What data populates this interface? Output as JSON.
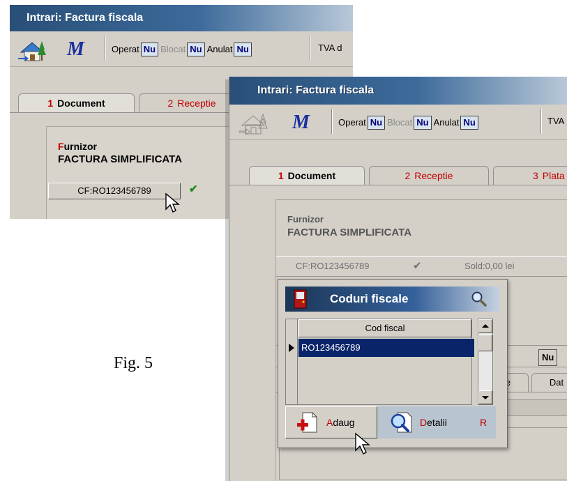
{
  "figure_caption": "Fig. 5",
  "back_window": {
    "title": "Intrari: Factura fiscala",
    "flags": [
      {
        "label": "Operat",
        "value": "Nu"
      },
      {
        "label": "Blocat",
        "value": "Nu"
      },
      {
        "label": "Anulat",
        "value": "Nu"
      }
    ],
    "tva_partial": "TVA d",
    "tabs": [
      {
        "num": "1",
        "label": "Document"
      },
      {
        "num": "2",
        "label": "Receptie"
      }
    ],
    "supplier_label_first": "F",
    "supplier_label_rest": "urnizor",
    "supplier_name": "FACTURA SIMPLIFICATA",
    "cf_button": "CF:RO123456789",
    "check": "✔"
  },
  "front_window": {
    "title": "Intrari: Factura fiscala",
    "flags": [
      {
        "label": "Operat",
        "value": "Nu"
      },
      {
        "label": "Blocat",
        "value": "Nu"
      },
      {
        "label": "Anulat",
        "value": "Nu"
      }
    ],
    "tva_partial": "TVA",
    "tabs": [
      {
        "num": "1",
        "label": "Document"
      },
      {
        "num": "2",
        "label": "Receptie"
      },
      {
        "num": "3",
        "label": "Plata"
      }
    ],
    "supplier_label": "Furnizor",
    "supplier_name": "FACTURA SIMPLIFICATA",
    "cf_text": "CF:RO123456789",
    "check": "✔",
    "sold": "Sold:0,00 lei",
    "nu_box": "Nu",
    "partial_tab_1": "le",
    "partial_tab_2": "Dat"
  },
  "popup": {
    "title": "Coduri fiscale",
    "column_header": "Cod fiscal",
    "rows": [
      "RO123456789"
    ],
    "add_hot": "A",
    "add_rest": "daug",
    "details_hot": "D",
    "details_rest": "etalii",
    "shortcut": "R"
  }
}
